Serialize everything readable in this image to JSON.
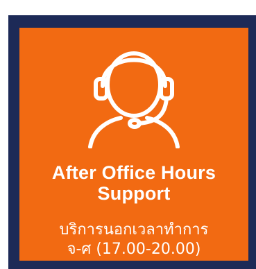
{
  "card": {
    "title_line1": "After Office Hours",
    "title_line2": "Support",
    "subtitle_line1": "บริการนอกเวลาทำการ",
    "subtitle_line2": "จ-ศ (17.00-20.00)",
    "icon": "headset-support-agent-icon"
  },
  "colors": {
    "card_background": "#f26a12",
    "backdrop": "#1d2a57",
    "text": "#ffffff"
  }
}
